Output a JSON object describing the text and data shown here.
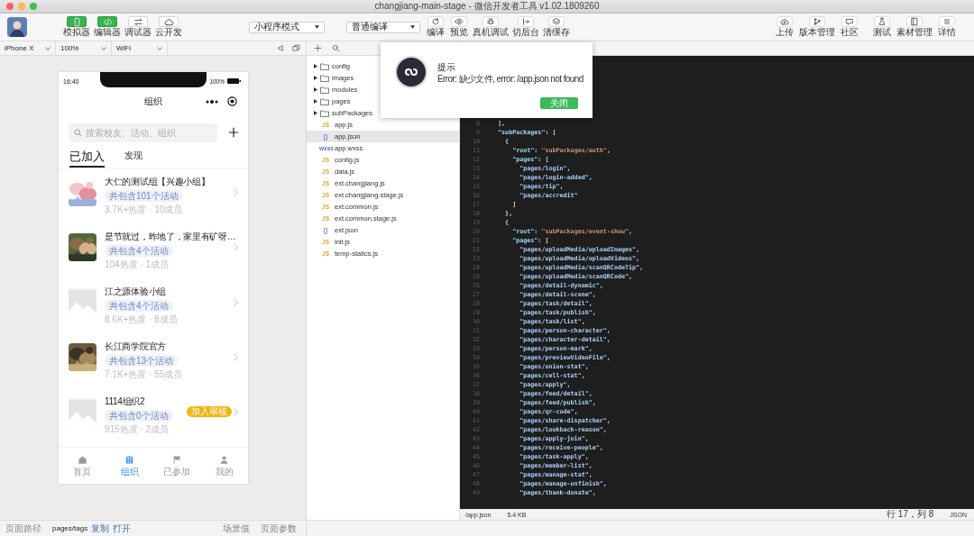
{
  "window": {
    "title": "changjiang-main-stage - 微信开发者工具 v1.02.1809260"
  },
  "toolbar": {
    "view_buttons": [
      {
        "label": "模拟器",
        "on": true
      },
      {
        "label": "编辑器",
        "on": true
      },
      {
        "label": "调试器",
        "on": false
      },
      {
        "label": "云开发",
        "on": false
      }
    ],
    "mode_select": "小程序模式",
    "compile_select": "普通编译",
    "actions": [
      "编译",
      "预览",
      "真机调试",
      "切后台",
      "清缓存"
    ],
    "right_actions": [
      "上传",
      "版本管理",
      "社区",
      "测试",
      "素材管理",
      "详情"
    ]
  },
  "simulator_bar": {
    "device": "iPhone X",
    "zoom": "100%",
    "network": "WiFi"
  },
  "phone": {
    "time": "16:40",
    "battery": "100%",
    "title": "组织",
    "search_placeholder": "搜索校友、活动、组织",
    "tabs": [
      {
        "label": "已加入",
        "selected": true
      },
      {
        "label": "发现",
        "selected": false
      }
    ],
    "groups": [
      {
        "title": "大仁的测试组【兴趣小组】",
        "tag": "共包含101个活动",
        "stats": "3.7K+热度 · 10成员"
      },
      {
        "title": "是节就过，昨地了，家里有矿呀…",
        "tag": "共包含4个活动",
        "stats": "104热度 · 1成员"
      },
      {
        "title": "江之源体验小组",
        "tag": "共包含4个活动",
        "stats": "8.6K+热度 · 8成员",
        "thumb": {
          "kind": "placeholder"
        }
      },
      {
        "title": "长江商学院官方",
        "tag": "共包含13个活动",
        "stats": "7.1K+热度 · 55成员"
      },
      {
        "title": "1114组织2",
        "tag": "共包含0个活动",
        "stats": "915热度 · 2成员",
        "thumb": {
          "kind": "placeholder"
        },
        "badge": "加入审核"
      }
    ],
    "tabbar": [
      {
        "label": "首页",
        "selected": false
      },
      {
        "label": "组织",
        "selected": true
      },
      {
        "label": "已参加",
        "selected": false
      },
      {
        "label": "我的",
        "selected": false
      }
    ]
  },
  "file_tree": [
    {
      "name": "config",
      "kind": "folder",
      "selected": false
    },
    {
      "name": "images",
      "kind": "folder",
      "selected": false
    },
    {
      "name": "modules",
      "kind": "folder",
      "selected": false
    },
    {
      "name": "pages",
      "kind": "folder",
      "selected": false
    },
    {
      "name": "subPackages",
      "kind": "folder",
      "selected": false
    },
    {
      "name": "app.js",
      "kind": "js",
      "icon": "JS",
      "selected": false
    },
    {
      "name": "app.json",
      "kind": "json",
      "icon": "{}",
      "selected": true
    },
    {
      "name": "app.wxss",
      "kind": "wxss",
      "icon": "wxss",
      "selected": false
    },
    {
      "name": "config.js",
      "kind": "js",
      "icon": "JS",
      "selected": false
    },
    {
      "name": "data.js",
      "kind": "js",
      "icon": "JS",
      "selected": false
    },
    {
      "name": "ext.changjiang.js",
      "kind": "js",
      "icon": "JS",
      "selected": false
    },
    {
      "name": "ext.changjiang.stage.js",
      "kind": "js",
      "icon": "JS",
      "selected": false
    },
    {
      "name": "ext.common.js",
      "kind": "js",
      "icon": "JS",
      "selected": false
    },
    {
      "name": "ext.common.stage.js",
      "kind": "js",
      "icon": "JS",
      "selected": false
    },
    {
      "name": "ext.json",
      "kind": "json",
      "icon": "{}",
      "selected": false
    },
    {
      "name": "init.js",
      "kind": "js",
      "icon": "JS",
      "selected": false
    },
    {
      "name": "temp-statics.js",
      "kind": "js",
      "icon": "JS",
      "selected": false
    }
  ],
  "editor": {
    "lines": [
      {
        "number": "8",
        "text": "  ],"
      },
      {
        "number": "9",
        "text": "  \"subPackages\": ["
      },
      {
        "number": "10",
        "text": "    {"
      },
      {
        "number": "11",
        "text": "      \"root\": \"subPackages/auth\","
      },
      {
        "number": "12",
        "text": "      \"pages\": ["
      },
      {
        "number": "13",
        "text": "        \"pages/login\","
      },
      {
        "number": "14",
        "text": "        \"pages/login-added\","
      },
      {
        "number": "15",
        "text": "        \"pages/tip\","
      },
      {
        "number": "16",
        "text": "        \"pages/accredit\""
      },
      {
        "number": "17",
        "text": "      ]"
      },
      {
        "number": "18",
        "text": "    },"
      },
      {
        "number": "19",
        "text": "    {"
      },
      {
        "number": "20",
        "text": "      \"root\": \"subPackages/event-show\","
      },
      {
        "number": "21",
        "text": "      \"pages\": ["
      },
      {
        "number": "22",
        "text": "        \"pages/uploadMedia/uploadImages\","
      },
      {
        "number": "23",
        "text": "        \"pages/uploadMedia/uploadVideos\","
      },
      {
        "number": "24",
        "text": "        \"pages/uploadMedia/scanQRCodeTip\","
      },
      {
        "number": "25",
        "text": "        \"pages/uploadMedia/scanQRCode\","
      },
      {
        "number": "26",
        "text": "        \"pages/detail-dynamic\","
      },
      {
        "number": "27",
        "text": "        \"pages/detail-scene\","
      },
      {
        "number": "28",
        "text": "        \"pages/task/detail\","
      },
      {
        "number": "29",
        "text": "        \"pages/task/publish\","
      },
      {
        "number": "30",
        "text": "        \"pages/task/list\","
      },
      {
        "number": "31",
        "text": "        \"pages/person-character\","
      },
      {
        "number": "32",
        "text": "        \"pages/character-detail\","
      },
      {
        "number": "33",
        "text": "        \"pages/person-mark\","
      },
      {
        "number": "34",
        "text": "        \"pages/previewVideoFile\","
      },
      {
        "number": "35",
        "text": "        \"pages/union-stat\","
      },
      {
        "number": "36",
        "text": "        \"pages/cell-stat\","
      },
      {
        "number": "37",
        "text": "        \"pages/apply\","
      },
      {
        "number": "38",
        "text": "        \"pages/feed/detail\","
      },
      {
        "number": "39",
        "text": "        \"pages/feed/publish\","
      },
      {
        "number": "40",
        "text": "        \"pages/qr-code\","
      },
      {
        "number": "41",
        "text": "        \"pages/share-dispatcher\","
      },
      {
        "number": "42",
        "text": "        \"pages/lookback-reason\","
      },
      {
        "number": "43",
        "text": "        \"pages/apply-join\","
      },
      {
        "number": "44",
        "text": "        \"pages/receive-people\","
      },
      {
        "number": "45",
        "text": "        \"pages/task-apply\","
      },
      {
        "number": "46",
        "text": "        \"pages/member-list\","
      },
      {
        "number": "47",
        "text": "        \"pages/manage-stat\","
      },
      {
        "number": "48",
        "text": "        \"pages/manage-unfinish\","
      },
      {
        "number": "49",
        "text": "        \"pages/thank-donate\","
      }
    ],
    "status": {
      "path": "/app.json",
      "size": "5.4 KB",
      "position": "行 17，列 8",
      "language": "JSON"
    }
  },
  "dialog": {
    "title": "提示",
    "message": "Error: 缺少文件, error: /app.json not found",
    "button": "关闭"
  },
  "footer": {
    "path_label": "页面路径",
    "path": "pages/tags",
    "links": [
      "复制",
      "打开"
    ],
    "scene": "场景值",
    "params": "页面参数"
  }
}
